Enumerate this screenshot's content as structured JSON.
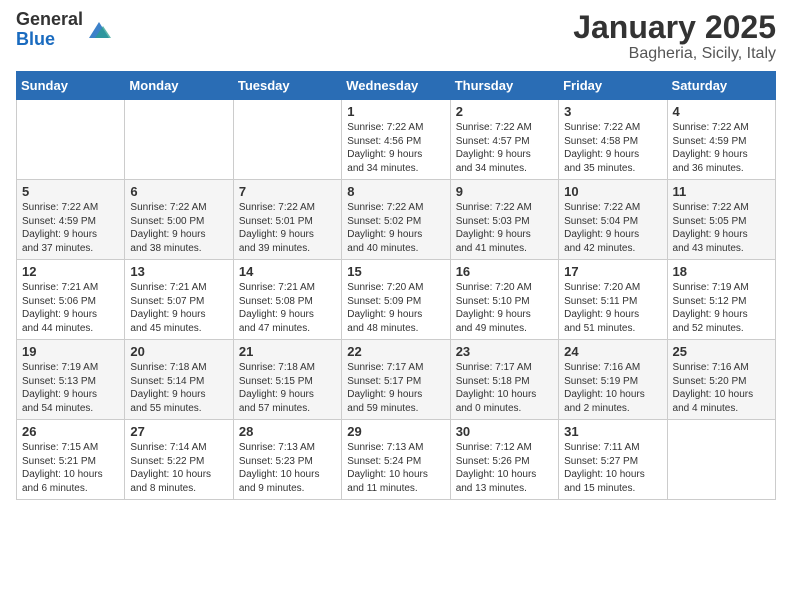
{
  "logo": {
    "general": "General",
    "blue": "Blue"
  },
  "header": {
    "month": "January 2025",
    "location": "Bagheria, Sicily, Italy"
  },
  "weekdays": [
    "Sunday",
    "Monday",
    "Tuesday",
    "Wednesday",
    "Thursday",
    "Friday",
    "Saturday"
  ],
  "weeks": [
    [
      {
        "day": "",
        "info": ""
      },
      {
        "day": "",
        "info": ""
      },
      {
        "day": "",
        "info": ""
      },
      {
        "day": "1",
        "info": "Sunrise: 7:22 AM\nSunset: 4:56 PM\nDaylight: 9 hours\nand 34 minutes."
      },
      {
        "day": "2",
        "info": "Sunrise: 7:22 AM\nSunset: 4:57 PM\nDaylight: 9 hours\nand 34 minutes."
      },
      {
        "day": "3",
        "info": "Sunrise: 7:22 AM\nSunset: 4:58 PM\nDaylight: 9 hours\nand 35 minutes."
      },
      {
        "day": "4",
        "info": "Sunrise: 7:22 AM\nSunset: 4:59 PM\nDaylight: 9 hours\nand 36 minutes."
      }
    ],
    [
      {
        "day": "5",
        "info": "Sunrise: 7:22 AM\nSunset: 4:59 PM\nDaylight: 9 hours\nand 37 minutes."
      },
      {
        "day": "6",
        "info": "Sunrise: 7:22 AM\nSunset: 5:00 PM\nDaylight: 9 hours\nand 38 minutes."
      },
      {
        "day": "7",
        "info": "Sunrise: 7:22 AM\nSunset: 5:01 PM\nDaylight: 9 hours\nand 39 minutes."
      },
      {
        "day": "8",
        "info": "Sunrise: 7:22 AM\nSunset: 5:02 PM\nDaylight: 9 hours\nand 40 minutes."
      },
      {
        "day": "9",
        "info": "Sunrise: 7:22 AM\nSunset: 5:03 PM\nDaylight: 9 hours\nand 41 minutes."
      },
      {
        "day": "10",
        "info": "Sunrise: 7:22 AM\nSunset: 5:04 PM\nDaylight: 9 hours\nand 42 minutes."
      },
      {
        "day": "11",
        "info": "Sunrise: 7:22 AM\nSunset: 5:05 PM\nDaylight: 9 hours\nand 43 minutes."
      }
    ],
    [
      {
        "day": "12",
        "info": "Sunrise: 7:21 AM\nSunset: 5:06 PM\nDaylight: 9 hours\nand 44 minutes."
      },
      {
        "day": "13",
        "info": "Sunrise: 7:21 AM\nSunset: 5:07 PM\nDaylight: 9 hours\nand 45 minutes."
      },
      {
        "day": "14",
        "info": "Sunrise: 7:21 AM\nSunset: 5:08 PM\nDaylight: 9 hours\nand 47 minutes."
      },
      {
        "day": "15",
        "info": "Sunrise: 7:20 AM\nSunset: 5:09 PM\nDaylight: 9 hours\nand 48 minutes."
      },
      {
        "day": "16",
        "info": "Sunrise: 7:20 AM\nSunset: 5:10 PM\nDaylight: 9 hours\nand 49 minutes."
      },
      {
        "day": "17",
        "info": "Sunrise: 7:20 AM\nSunset: 5:11 PM\nDaylight: 9 hours\nand 51 minutes."
      },
      {
        "day": "18",
        "info": "Sunrise: 7:19 AM\nSunset: 5:12 PM\nDaylight: 9 hours\nand 52 minutes."
      }
    ],
    [
      {
        "day": "19",
        "info": "Sunrise: 7:19 AM\nSunset: 5:13 PM\nDaylight: 9 hours\nand 54 minutes."
      },
      {
        "day": "20",
        "info": "Sunrise: 7:18 AM\nSunset: 5:14 PM\nDaylight: 9 hours\nand 55 minutes."
      },
      {
        "day": "21",
        "info": "Sunrise: 7:18 AM\nSunset: 5:15 PM\nDaylight: 9 hours\nand 57 minutes."
      },
      {
        "day": "22",
        "info": "Sunrise: 7:17 AM\nSunset: 5:17 PM\nDaylight: 9 hours\nand 59 minutes."
      },
      {
        "day": "23",
        "info": "Sunrise: 7:17 AM\nSunset: 5:18 PM\nDaylight: 10 hours\nand 0 minutes."
      },
      {
        "day": "24",
        "info": "Sunrise: 7:16 AM\nSunset: 5:19 PM\nDaylight: 10 hours\nand 2 minutes."
      },
      {
        "day": "25",
        "info": "Sunrise: 7:16 AM\nSunset: 5:20 PM\nDaylight: 10 hours\nand 4 minutes."
      }
    ],
    [
      {
        "day": "26",
        "info": "Sunrise: 7:15 AM\nSunset: 5:21 PM\nDaylight: 10 hours\nand 6 minutes."
      },
      {
        "day": "27",
        "info": "Sunrise: 7:14 AM\nSunset: 5:22 PM\nDaylight: 10 hours\nand 8 minutes."
      },
      {
        "day": "28",
        "info": "Sunrise: 7:13 AM\nSunset: 5:23 PM\nDaylight: 10 hours\nand 9 minutes."
      },
      {
        "day": "29",
        "info": "Sunrise: 7:13 AM\nSunset: 5:24 PM\nDaylight: 10 hours\nand 11 minutes."
      },
      {
        "day": "30",
        "info": "Sunrise: 7:12 AM\nSunset: 5:26 PM\nDaylight: 10 hours\nand 13 minutes."
      },
      {
        "day": "31",
        "info": "Sunrise: 7:11 AM\nSunset: 5:27 PM\nDaylight: 10 hours\nand 15 minutes."
      },
      {
        "day": "",
        "info": ""
      }
    ]
  ]
}
